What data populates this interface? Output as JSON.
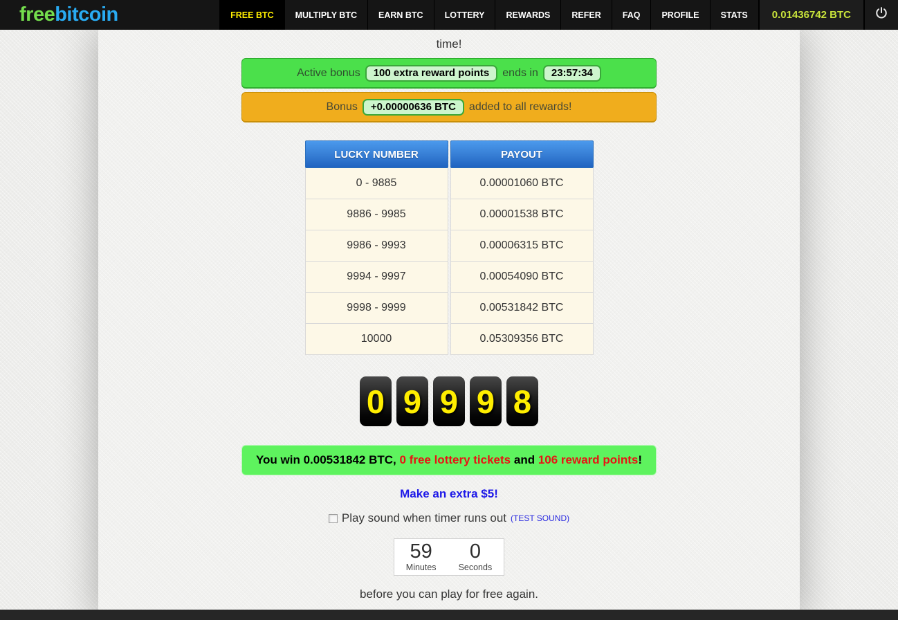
{
  "nav": {
    "logo": {
      "part1": "free",
      "part2": "bitcoin"
    },
    "items": [
      {
        "label": "FREE BTC",
        "active": true
      },
      {
        "label": "MULTIPLY BTC",
        "active": false
      },
      {
        "label": "EARN BTC",
        "active": false
      },
      {
        "label": "LOTTERY",
        "active": false
      },
      {
        "label": "REWARDS",
        "active": false
      },
      {
        "label": "REFER",
        "active": false
      },
      {
        "label": "FAQ",
        "active": false
      },
      {
        "label": "PROFILE",
        "active": false
      },
      {
        "label": "STATS",
        "active": false
      }
    ],
    "balance": "0.01436742 BTC",
    "logout_icon": "power-icon"
  },
  "intro_text": "time!",
  "active_bonus_banner": {
    "prefix": "Active bonus",
    "bonus_badge": "100 extra reward points",
    "middle": "ends in",
    "time_badge": "23:57:34"
  },
  "bonus_banner": {
    "prefix": "Bonus",
    "amount_badge": "+0.00000636 BTC",
    "suffix": "added to all rewards!"
  },
  "payout_table": {
    "headers": [
      "LUCKY NUMBER",
      "PAYOUT"
    ],
    "rows": [
      [
        "0 - 9885",
        "0.00001060 BTC"
      ],
      [
        "9886 - 9985",
        "0.00001538 BTC"
      ],
      [
        "9986 - 9993",
        "0.00006315 BTC"
      ],
      [
        "9994 - 9997",
        "0.00054090 BTC"
      ],
      [
        "9998 - 9999",
        "0.00531842 BTC"
      ],
      [
        "10000",
        "0.05309356 BTC"
      ]
    ]
  },
  "roll_result": {
    "digits": [
      "0",
      "9",
      "9",
      "9",
      "8"
    ]
  },
  "win_message": {
    "part1": "You win 0.00531842 BTC, ",
    "highlight1": "0 free lottery tickets",
    "part2": " and ",
    "highlight2": "106 reward points",
    "part3": "!"
  },
  "extra_link": "Make an extra $5!",
  "sound_row": {
    "label": "Play sound when timer runs out",
    "test_link": "(TEST SOUND)",
    "checked": false
  },
  "timer": {
    "minutes": "59",
    "minutes_label": "Minutes",
    "seconds": "0",
    "seconds_label": "Seconds"
  },
  "footer_note": "before you can play for free again.",
  "colors": {
    "brand_green": "#74dd4d",
    "brand_blue": "#29abf2",
    "active_tab_text": "#ffee00",
    "balance_text": "#c9e43b",
    "active_bonus_bg": "#4be04b",
    "bonus_bg": "#f0ad1d",
    "win_bg": "#5ef35e",
    "win_highlight": "#e81414",
    "table_header_blue": "#2f74cc",
    "table_cell_cream": "#fdf8e7",
    "digit_text": "#ffee00"
  }
}
